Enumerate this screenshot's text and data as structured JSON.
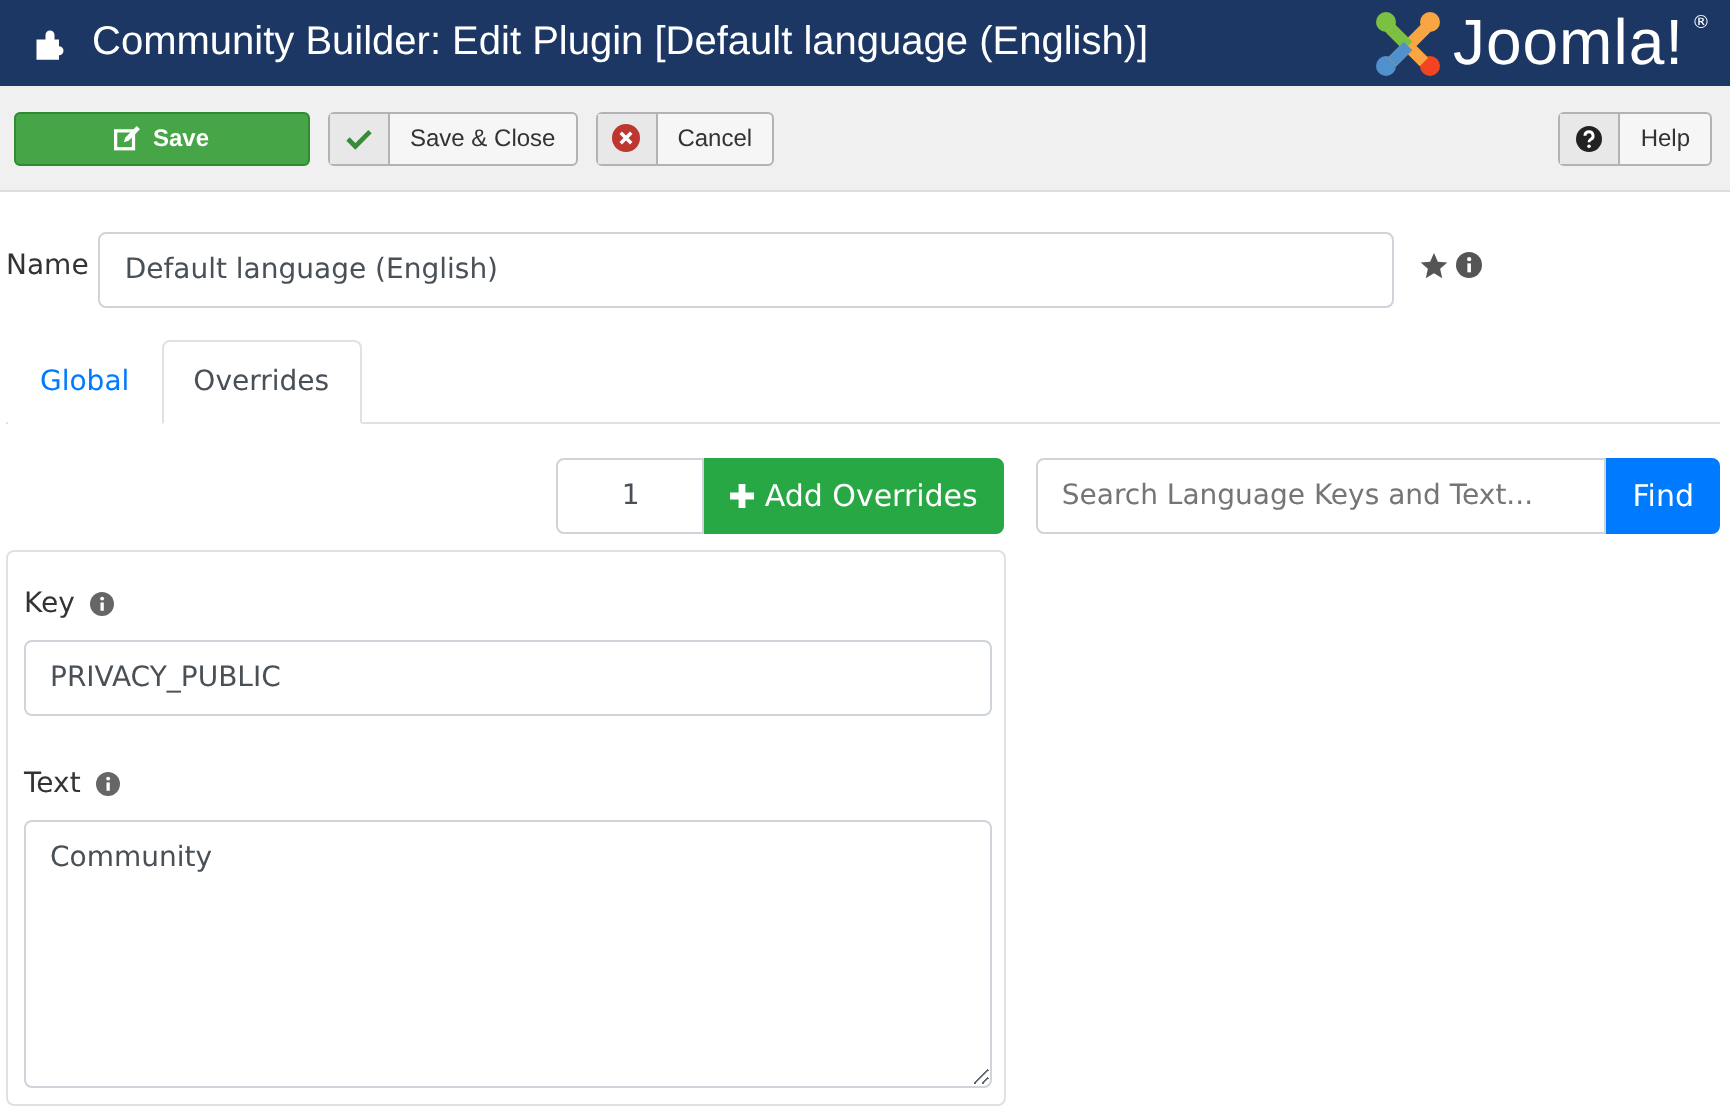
{
  "header": {
    "title": "Community Builder: Edit Plugin [Default language (English)]",
    "logo": "Joomla!",
    "logo_mark": "®"
  },
  "toolbar": [
    {
      "label": "Save",
      "kind": "save"
    },
    {
      "label": "Save & Close",
      "kind": "close"
    },
    {
      "label": "Cancel",
      "kind": "cancel"
    },
    {
      "label": "Help",
      "kind": "help"
    }
  ],
  "name_field": {
    "label": "Name",
    "value": "Default language (English)"
  },
  "tabs": [
    {
      "label": "Global",
      "selected": false
    },
    {
      "label": "Overrides",
      "selected": true
    }
  ],
  "add_overrides": {
    "count": "1",
    "button": "Add Overrides"
  },
  "search": {
    "placeholder": "Search Language Keys and Text...",
    "button": "Find"
  },
  "override": {
    "key_label": "Key",
    "key_value": "PRIVACY_PUBLIC",
    "text_label": "Text",
    "text_value": "Community"
  }
}
